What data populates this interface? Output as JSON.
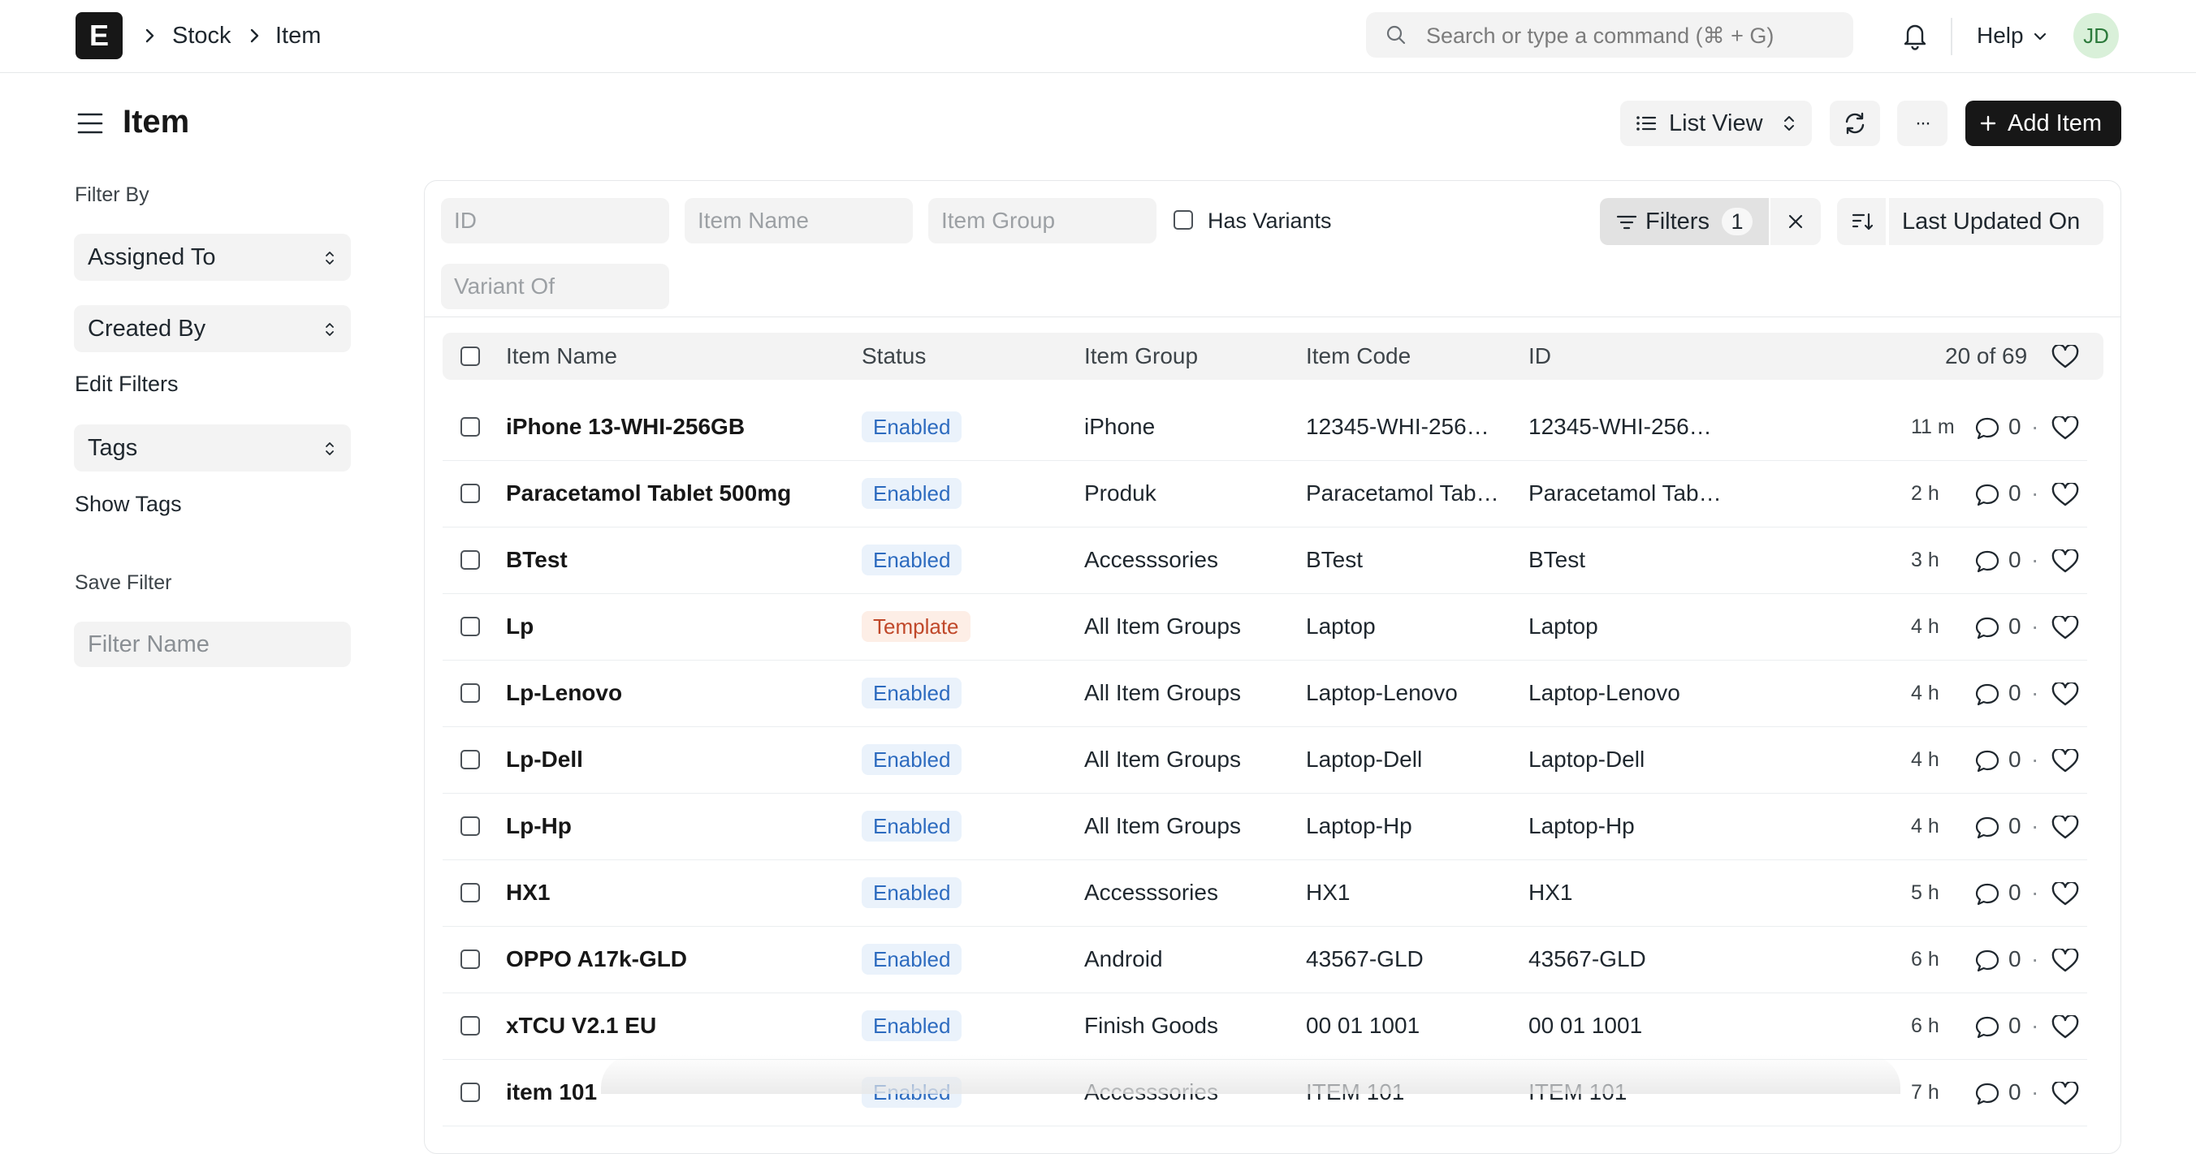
{
  "navbar": {
    "logo_letter": "E",
    "breadcrumbs": [
      "Stock",
      "Item"
    ],
    "search_placeholder": "Search or type a command (⌘ + G)",
    "help_label": "Help",
    "avatar_initials": "JD"
  },
  "page": {
    "title": "Item",
    "list_view_label": "List View",
    "more_label": "···",
    "add_label": "Add Item"
  },
  "sidebar": {
    "filter_by_label": "Filter By",
    "assigned_to": "Assigned To",
    "created_by": "Created By",
    "edit_filters": "Edit Filters",
    "tags": "Tags",
    "show_tags": "Show Tags",
    "save_filter_label": "Save Filter",
    "filter_name_placeholder": "Filter Name"
  },
  "filters": {
    "id_placeholder": "ID",
    "item_name_placeholder": "Item Name",
    "item_group_placeholder": "Item Group",
    "has_variants_label": "Has Variants",
    "variant_of_placeholder": "Variant Of",
    "filters_label": "Filters",
    "filters_count": "1",
    "sort_field": "Last Updated On"
  },
  "table": {
    "columns": [
      "Item Name",
      "Status",
      "Item Group",
      "Item Code",
      "ID"
    ],
    "count_label": "20 of 69",
    "rows": [
      {
        "name": "iPhone 13-WHI-256GB",
        "status": "Enabled",
        "group": "iPhone",
        "code": "12345-WHI-256…",
        "id": "12345-WHI-256…",
        "modified": "11 m",
        "comments": "0"
      },
      {
        "name": "Paracetamol Tablet 500mg",
        "status": "Enabled",
        "group": "Produk",
        "code": "Paracetamol Tab…",
        "id": "Paracetamol Tab…",
        "modified": "2 h",
        "comments": "0"
      },
      {
        "name": "BTest",
        "status": "Enabled",
        "group": "Accesssories",
        "code": "BTest",
        "id": "BTest",
        "modified": "3 h",
        "comments": "0"
      },
      {
        "name": "Lp",
        "status": "Template",
        "group": "All Item Groups",
        "code": "Laptop",
        "id": "Laptop",
        "modified": "4 h",
        "comments": "0"
      },
      {
        "name": "Lp-Lenovo",
        "status": "Enabled",
        "group": "All Item Groups",
        "code": "Laptop-Lenovo",
        "id": "Laptop-Lenovo",
        "modified": "4 h",
        "comments": "0"
      },
      {
        "name": "Lp-Dell",
        "status": "Enabled",
        "group": "All Item Groups",
        "code": "Laptop-Dell",
        "id": "Laptop-Dell",
        "modified": "4 h",
        "comments": "0"
      },
      {
        "name": "Lp-Hp",
        "status": "Enabled",
        "group": "All Item Groups",
        "code": "Laptop-Hp",
        "id": "Laptop-Hp",
        "modified": "4 h",
        "comments": "0"
      },
      {
        "name": "HX1",
        "status": "Enabled",
        "group": "Accesssories",
        "code": "HX1",
        "id": "HX1",
        "modified": "5 h",
        "comments": "0"
      },
      {
        "name": "OPPO A17k-GLD",
        "status": "Enabled",
        "group": "Android",
        "code": "43567-GLD",
        "id": "43567-GLD",
        "modified": "6 h",
        "comments": "0"
      },
      {
        "name": "xTCU V2.1 EU",
        "status": "Enabled",
        "group": "Finish Goods",
        "code": "00 01 1001",
        "id": "00 01 1001",
        "modified": "6 h",
        "comments": "0"
      },
      {
        "name": "item 101",
        "status": "Enabled",
        "group": "Accesssories",
        "code": "ITEM 101",
        "id": "ITEM 101",
        "modified": "7 h",
        "comments": "0"
      }
    ]
  }
}
